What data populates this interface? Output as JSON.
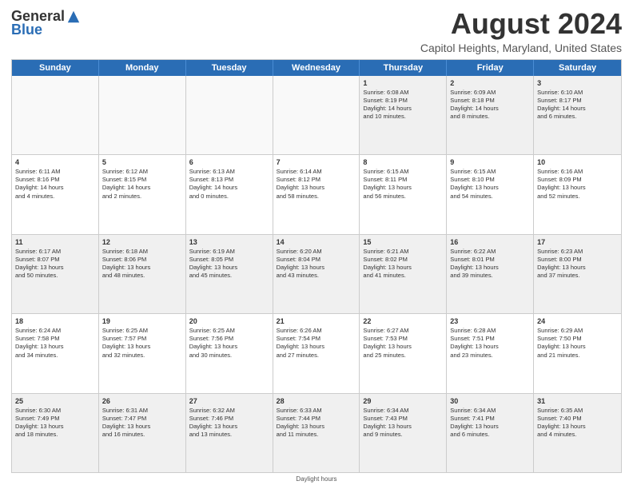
{
  "logo": {
    "general": "General",
    "blue": "Blue"
  },
  "title": "August 2024",
  "subtitle": "Capitol Heights, Maryland, United States",
  "weekdays": [
    "Sunday",
    "Monday",
    "Tuesday",
    "Wednesday",
    "Thursday",
    "Friday",
    "Saturday"
  ],
  "footer": "Daylight hours",
  "rows": [
    [
      {
        "day": "",
        "info": ""
      },
      {
        "day": "",
        "info": ""
      },
      {
        "day": "",
        "info": ""
      },
      {
        "day": "",
        "info": ""
      },
      {
        "day": "1",
        "info": "Sunrise: 6:08 AM\nSunset: 8:19 PM\nDaylight: 14 hours\nand 10 minutes."
      },
      {
        "day": "2",
        "info": "Sunrise: 6:09 AM\nSunset: 8:18 PM\nDaylight: 14 hours\nand 8 minutes."
      },
      {
        "day": "3",
        "info": "Sunrise: 6:10 AM\nSunset: 8:17 PM\nDaylight: 14 hours\nand 6 minutes."
      }
    ],
    [
      {
        "day": "4",
        "info": "Sunrise: 6:11 AM\nSunset: 8:16 PM\nDaylight: 14 hours\nand 4 minutes."
      },
      {
        "day": "5",
        "info": "Sunrise: 6:12 AM\nSunset: 8:15 PM\nDaylight: 14 hours\nand 2 minutes."
      },
      {
        "day": "6",
        "info": "Sunrise: 6:13 AM\nSunset: 8:13 PM\nDaylight: 14 hours\nand 0 minutes."
      },
      {
        "day": "7",
        "info": "Sunrise: 6:14 AM\nSunset: 8:12 PM\nDaylight: 13 hours\nand 58 minutes."
      },
      {
        "day": "8",
        "info": "Sunrise: 6:15 AM\nSunset: 8:11 PM\nDaylight: 13 hours\nand 56 minutes."
      },
      {
        "day": "9",
        "info": "Sunrise: 6:15 AM\nSunset: 8:10 PM\nDaylight: 13 hours\nand 54 minutes."
      },
      {
        "day": "10",
        "info": "Sunrise: 6:16 AM\nSunset: 8:09 PM\nDaylight: 13 hours\nand 52 minutes."
      }
    ],
    [
      {
        "day": "11",
        "info": "Sunrise: 6:17 AM\nSunset: 8:07 PM\nDaylight: 13 hours\nand 50 minutes."
      },
      {
        "day": "12",
        "info": "Sunrise: 6:18 AM\nSunset: 8:06 PM\nDaylight: 13 hours\nand 48 minutes."
      },
      {
        "day": "13",
        "info": "Sunrise: 6:19 AM\nSunset: 8:05 PM\nDaylight: 13 hours\nand 45 minutes."
      },
      {
        "day": "14",
        "info": "Sunrise: 6:20 AM\nSunset: 8:04 PM\nDaylight: 13 hours\nand 43 minutes."
      },
      {
        "day": "15",
        "info": "Sunrise: 6:21 AM\nSunset: 8:02 PM\nDaylight: 13 hours\nand 41 minutes."
      },
      {
        "day": "16",
        "info": "Sunrise: 6:22 AM\nSunset: 8:01 PM\nDaylight: 13 hours\nand 39 minutes."
      },
      {
        "day": "17",
        "info": "Sunrise: 6:23 AM\nSunset: 8:00 PM\nDaylight: 13 hours\nand 37 minutes."
      }
    ],
    [
      {
        "day": "18",
        "info": "Sunrise: 6:24 AM\nSunset: 7:58 PM\nDaylight: 13 hours\nand 34 minutes."
      },
      {
        "day": "19",
        "info": "Sunrise: 6:25 AM\nSunset: 7:57 PM\nDaylight: 13 hours\nand 32 minutes."
      },
      {
        "day": "20",
        "info": "Sunrise: 6:25 AM\nSunset: 7:56 PM\nDaylight: 13 hours\nand 30 minutes."
      },
      {
        "day": "21",
        "info": "Sunrise: 6:26 AM\nSunset: 7:54 PM\nDaylight: 13 hours\nand 27 minutes."
      },
      {
        "day": "22",
        "info": "Sunrise: 6:27 AM\nSunset: 7:53 PM\nDaylight: 13 hours\nand 25 minutes."
      },
      {
        "day": "23",
        "info": "Sunrise: 6:28 AM\nSunset: 7:51 PM\nDaylight: 13 hours\nand 23 minutes."
      },
      {
        "day": "24",
        "info": "Sunrise: 6:29 AM\nSunset: 7:50 PM\nDaylight: 13 hours\nand 21 minutes."
      }
    ],
    [
      {
        "day": "25",
        "info": "Sunrise: 6:30 AM\nSunset: 7:49 PM\nDaylight: 13 hours\nand 18 minutes."
      },
      {
        "day": "26",
        "info": "Sunrise: 6:31 AM\nSunset: 7:47 PM\nDaylight: 13 hours\nand 16 minutes."
      },
      {
        "day": "27",
        "info": "Sunrise: 6:32 AM\nSunset: 7:46 PM\nDaylight: 13 hours\nand 13 minutes."
      },
      {
        "day": "28",
        "info": "Sunrise: 6:33 AM\nSunset: 7:44 PM\nDaylight: 13 hours\nand 11 minutes."
      },
      {
        "day": "29",
        "info": "Sunrise: 6:34 AM\nSunset: 7:43 PM\nDaylight: 13 hours\nand 9 minutes."
      },
      {
        "day": "30",
        "info": "Sunrise: 6:34 AM\nSunset: 7:41 PM\nDaylight: 13 hours\nand 6 minutes."
      },
      {
        "day": "31",
        "info": "Sunrise: 6:35 AM\nSunset: 7:40 PM\nDaylight: 13 hours\nand 4 minutes."
      }
    ]
  ]
}
